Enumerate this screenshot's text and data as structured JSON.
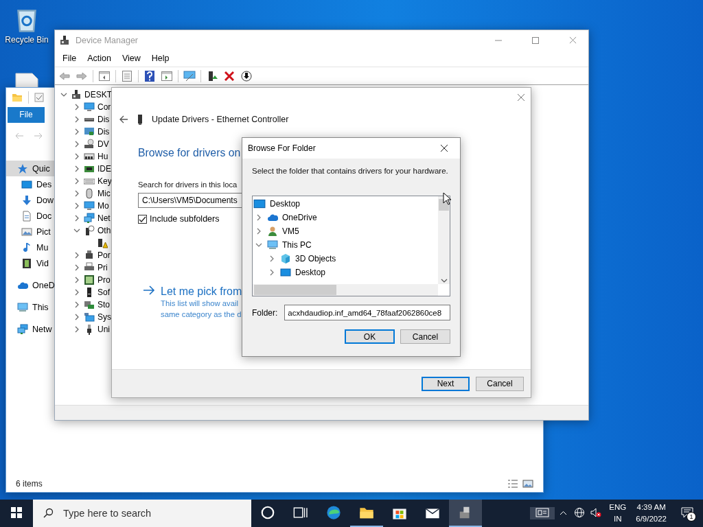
{
  "desktop": {
    "icons": [
      {
        "label": "Recycle Bin",
        "kind": "recycle-bin"
      }
    ]
  },
  "explorer": {
    "ribbon_tab": "File",
    "nav_items": [
      {
        "label": "Quic",
        "kind": "star",
        "selected": true,
        "children": [
          {
            "label": "Des",
            "kind": "desktop",
            "selected": false
          },
          {
            "label": "Dow",
            "kind": "download",
            "selected": false
          },
          {
            "label": "Doc",
            "kind": "document",
            "selected": false
          },
          {
            "label": "Pict",
            "kind": "picture",
            "selected": false
          },
          {
            "label": "Mu",
            "kind": "music",
            "selected": false
          },
          {
            "label": "Vid",
            "kind": "video",
            "selected": false
          }
        ]
      },
      {
        "label": "OneD",
        "kind": "cloud",
        "selected": false
      },
      {
        "label": "This",
        "kind": "pc",
        "selected": false
      },
      {
        "label": "Netw",
        "kind": "network",
        "selected": false
      }
    ],
    "status": "6 items"
  },
  "device_manager": {
    "title": "Device Manager",
    "menu": [
      "File",
      "Action",
      "View",
      "Help"
    ],
    "tree": [
      {
        "label": "DESKT",
        "kind": "computer",
        "expanded": true,
        "children": [
          {
            "label": "Cor",
            "kind": "monitor",
            "expanded": false
          },
          {
            "label": "Dis",
            "kind": "disk",
            "expanded": false
          },
          {
            "label": "Dis",
            "kind": "display",
            "expanded": false
          },
          {
            "label": "DV",
            "kind": "dvd",
            "expanded": false
          },
          {
            "label": "Hu",
            "kind": "hid",
            "expanded": false
          },
          {
            "label": "IDE",
            "kind": "ide",
            "expanded": false
          },
          {
            "label": "Key",
            "kind": "keyboard",
            "expanded": false
          },
          {
            "label": "Mic",
            "kind": "mouse",
            "expanded": false
          },
          {
            "label": "Mo",
            "kind": "monitor",
            "expanded": false
          },
          {
            "label": "Net",
            "kind": "network",
            "expanded": false
          },
          {
            "label": "Oth",
            "kind": "other",
            "expanded": true,
            "children": [
              {
                "kind": "warning"
              }
            ]
          },
          {
            "label": "Por",
            "kind": "port",
            "expanded": false
          },
          {
            "label": "Pri",
            "kind": "printer",
            "expanded": false
          },
          {
            "label": "Pro",
            "kind": "processor",
            "expanded": false
          },
          {
            "label": "Sof",
            "kind": "software",
            "expanded": false
          },
          {
            "label": "Sto",
            "kind": "storage",
            "expanded": false
          },
          {
            "label": "Sys",
            "kind": "system",
            "expanded": false
          },
          {
            "label": "Uni",
            "kind": "usb",
            "expanded": false
          }
        ]
      }
    ]
  },
  "update_drivers": {
    "title": "Update Drivers - Ethernet Controller",
    "heading": "Browse for drivers on",
    "search_label": "Search for drivers in this loca",
    "path": "C:\\Users\\VM5\\Documents",
    "include_subfolders": {
      "label": "Include subfolders",
      "checked": true
    },
    "pick_link": {
      "title": "Let me pick from",
      "lines": [
        "This list will show avail",
        "same category as the d"
      ]
    },
    "buttons": [
      {
        "label": "Next",
        "default": true
      },
      {
        "label": "Cancel",
        "default": false
      }
    ]
  },
  "browse_folder": {
    "title": "Browse For Folder",
    "prompt": "Select the folder that contains drivers for your hardware.",
    "tree": [
      {
        "label": "Desktop",
        "kind": "desktop",
        "children": [
          {
            "label": "OneDrive",
            "kind": "cloud",
            "expanded": false
          },
          {
            "label": "VM5",
            "kind": "user",
            "expanded": false
          },
          {
            "label": "This PC",
            "kind": "pc",
            "expanded": true,
            "children": [
              {
                "label": "3D Objects",
                "kind": "cube",
                "expanded": false
              },
              {
                "label": "Desktop",
                "kind": "desktop",
                "expanded": false
              }
            ]
          }
        ]
      }
    ],
    "folder_label": "Folder:",
    "folder_value": "acxhdaudiop.inf_amd64_78faaf2062860ce8",
    "buttons": [
      {
        "label": "OK",
        "default": true
      },
      {
        "label": "Cancel",
        "default": false
      }
    ]
  },
  "taskbar": {
    "search_placeholder": "Type here to search",
    "apps": [
      {
        "kind": "cortana",
        "running": false,
        "selected": false
      },
      {
        "kind": "task-view",
        "running": false,
        "selected": false
      },
      {
        "kind": "edge",
        "running": false,
        "selected": false
      },
      {
        "kind": "folder",
        "running": true,
        "selected": false
      },
      {
        "kind": "store",
        "running": false,
        "selected": false
      },
      {
        "kind": "mail",
        "running": false,
        "selected": false
      },
      {
        "kind": "device-manager",
        "running": true,
        "selected": true
      }
    ],
    "language": [
      "ENG",
      "IN"
    ],
    "time": "4:39 AM",
    "date": "6/9/2022",
    "notification_count": "1"
  }
}
